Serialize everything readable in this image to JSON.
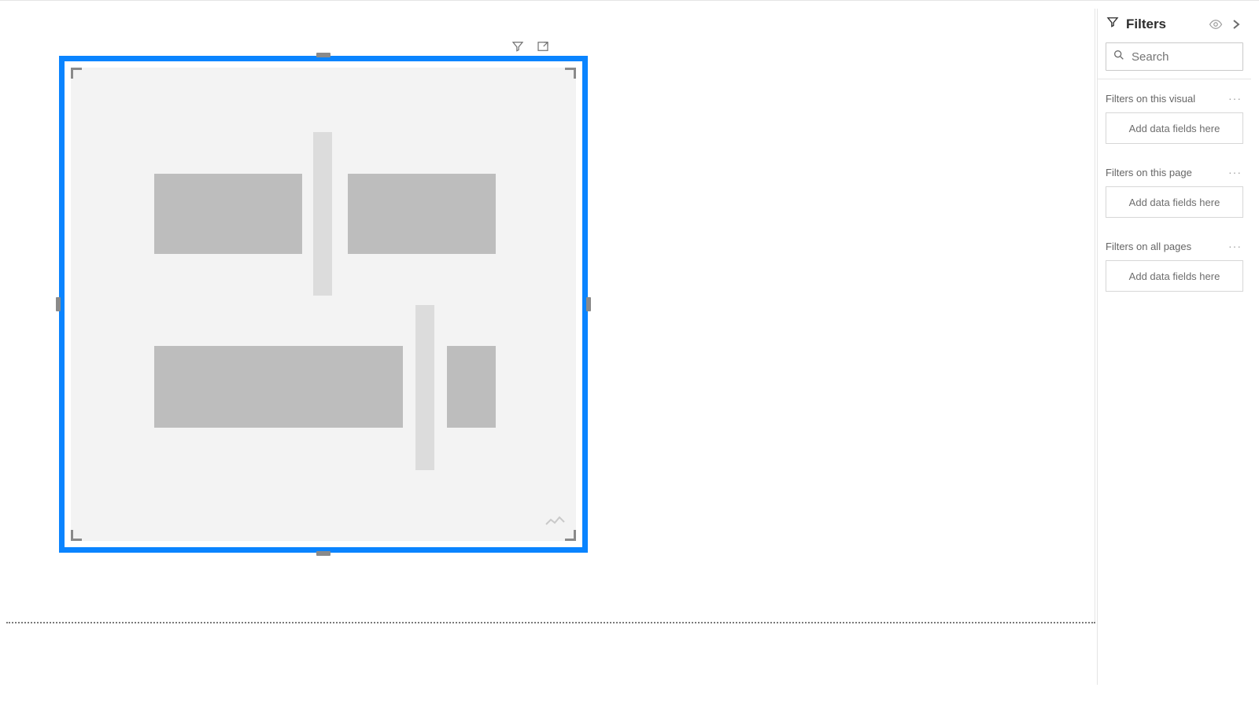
{
  "filters_panel": {
    "title": "Filters",
    "search_placeholder": "Search",
    "sections": [
      {
        "title": "Filters on this visual",
        "placeholder": "Add data fields here"
      },
      {
        "title": "Filters on this page",
        "placeholder": "Add data fields here"
      },
      {
        "title": "Filters on all pages",
        "placeholder": "Add data fields here"
      }
    ]
  },
  "colors": {
    "selection": "#0a84ff",
    "placeholder_dark": "#bdbdbd",
    "placeholder_light": "#dcdcdc"
  }
}
